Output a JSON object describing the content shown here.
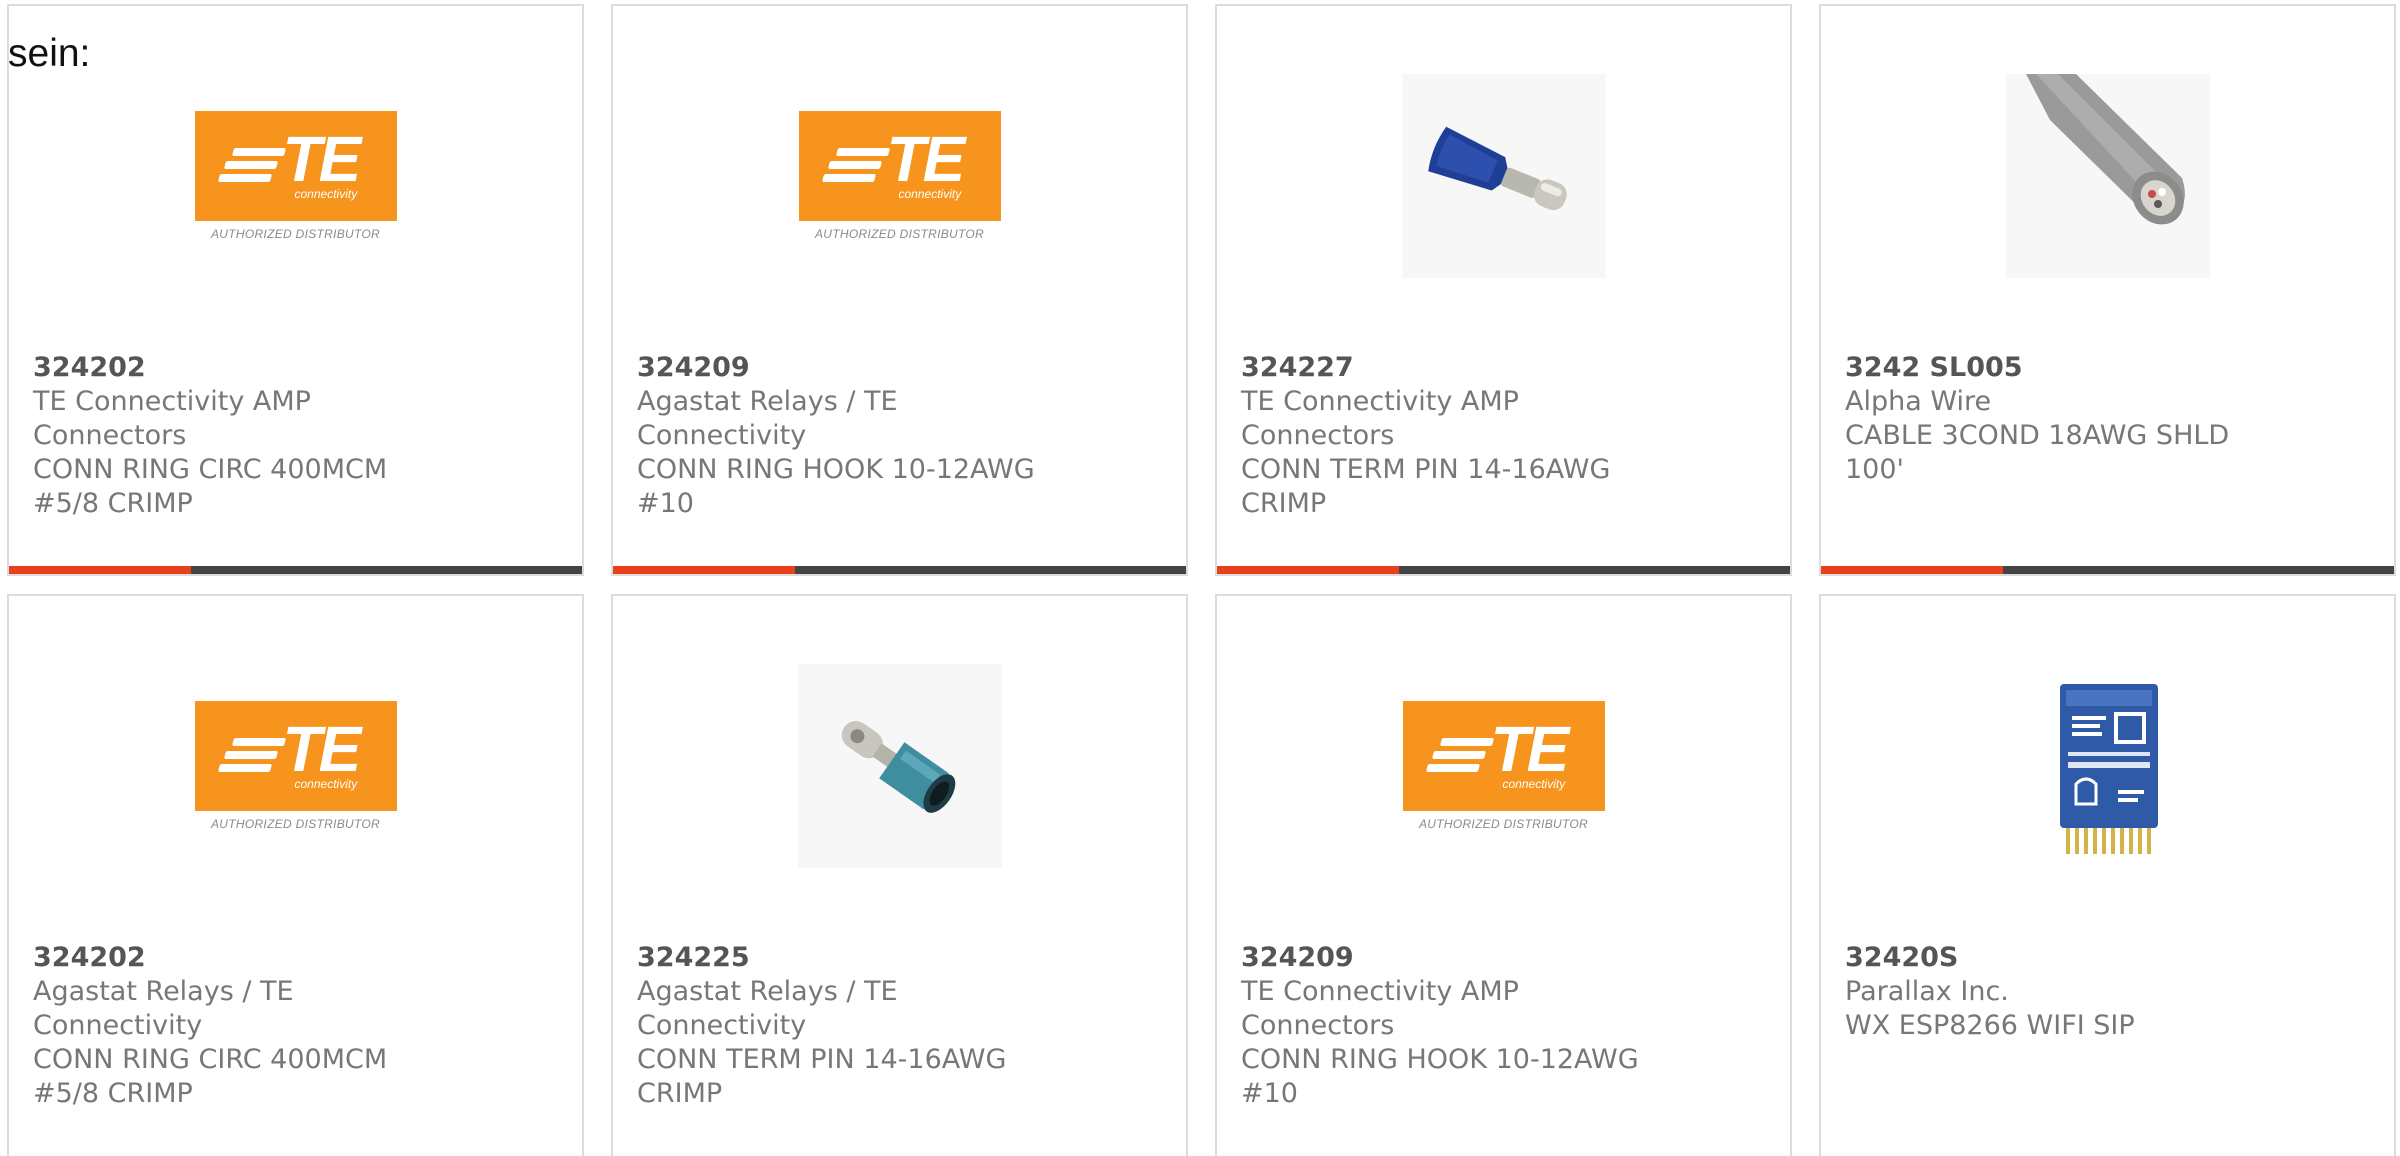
{
  "intro_text": "sein:",
  "logo": {
    "letters": "TE",
    "sub": "connectivity",
    "distributor": "AUTHORIZED DISTRIBUTOR"
  },
  "colors": {
    "brand_orange": "#f7941d",
    "accent_red": "#e8401c",
    "accent_dark": "#444444"
  },
  "products": [
    {
      "part_number": "324202",
      "manufacturer": "TE Connectivity AMP Connectors",
      "description": "CONN RING CIRC 400MCM #5/8 CRIMP",
      "image": "te-logo"
    },
    {
      "part_number": "324209",
      "manufacturer": "Agastat Relays / TE Connectivity",
      "description": "CONN RING HOOK 10-12AWG #10",
      "image": "te-logo"
    },
    {
      "part_number": "324227",
      "manufacturer": "TE Connectivity AMP Connectors",
      "description": "CONN TERM PIN 14-16AWG CRIMP",
      "image": "blue-pin-terminal"
    },
    {
      "part_number": "3242 SL005",
      "manufacturer": "Alpha Wire",
      "description": "CABLE 3COND 18AWG SHLD 100'",
      "image": "grey-cable"
    },
    {
      "part_number": "324202",
      "manufacturer": "Agastat Relays / TE Connectivity",
      "description": "CONN RING CIRC 400MCM #5/8 CRIMP",
      "image": "te-logo"
    },
    {
      "part_number": "324225",
      "manufacturer": "Agastat Relays / TE Connectivity",
      "description": "CONN TERM PIN 14-16AWG CRIMP",
      "image": "teal-pin-terminal"
    },
    {
      "part_number": "324209",
      "manufacturer": "TE Connectivity AMP Connectors",
      "description": "CONN RING HOOK 10-12AWG #10",
      "image": "te-logo"
    },
    {
      "part_number": "32420S",
      "manufacturer": "Parallax Inc.",
      "description": "WX ESP8266 WIFI SIP",
      "image": "wifi-module"
    }
  ]
}
